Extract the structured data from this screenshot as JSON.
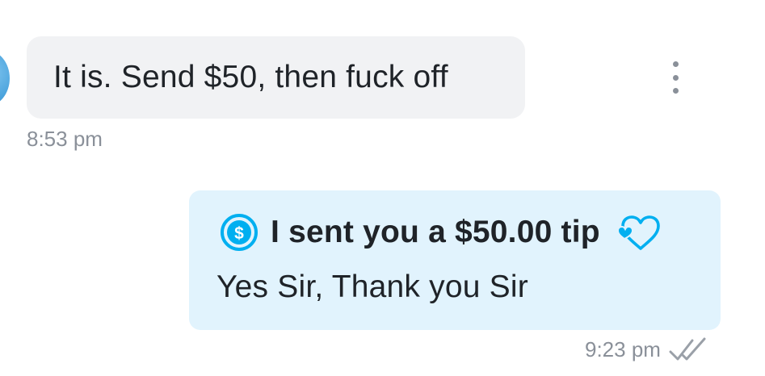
{
  "incoming": {
    "text": "It is. Send $50, then fuck off",
    "time": "8:53 pm"
  },
  "outgoing": {
    "tip_text": "I sent you a $50.00 tip",
    "text": "Yes Sir, Thank you Sir",
    "time": "9:23 pm",
    "status": "read"
  },
  "icons": {
    "more": "more-vertical-icon",
    "tip": "dollar-circle-icon",
    "heart": "heart-outline-icon",
    "read": "double-check-icon"
  },
  "colors": {
    "accent": "#00aff0",
    "incoming_bubble": "#f1f2f4",
    "outgoing_bubble": "#e1f3fd",
    "meta_text": "#8a9099"
  }
}
